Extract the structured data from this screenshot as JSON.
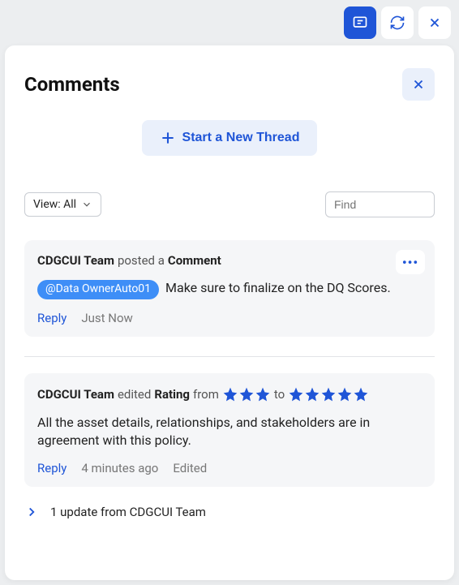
{
  "panel": {
    "title": "Comments"
  },
  "actions": {
    "new_thread_label": "Start a New Thread",
    "view_label": "View: All"
  },
  "search": {
    "placeholder": "Find"
  },
  "comment1": {
    "author": "CDGCUI Team",
    "action": "posted a",
    "object": "Comment",
    "mention": "@Data OwnerAuto01",
    "body_rest": "Make sure to finalize on the DQ Scores.",
    "reply_label": "Reply",
    "timestamp": "Just Now"
  },
  "comment2": {
    "author": "CDGCUI Team",
    "action": "edited",
    "object": "Rating",
    "from_label": "from",
    "to_label": "to",
    "from_stars": 3,
    "to_stars": 5,
    "body": "All the asset details, relationships, and stakeholders are in agreement with this policy.",
    "reply_label": "Reply",
    "timestamp": "4 minutes ago",
    "edited_label": "Edited"
  },
  "updates": {
    "text": "1 update from CDGCUI Team"
  }
}
